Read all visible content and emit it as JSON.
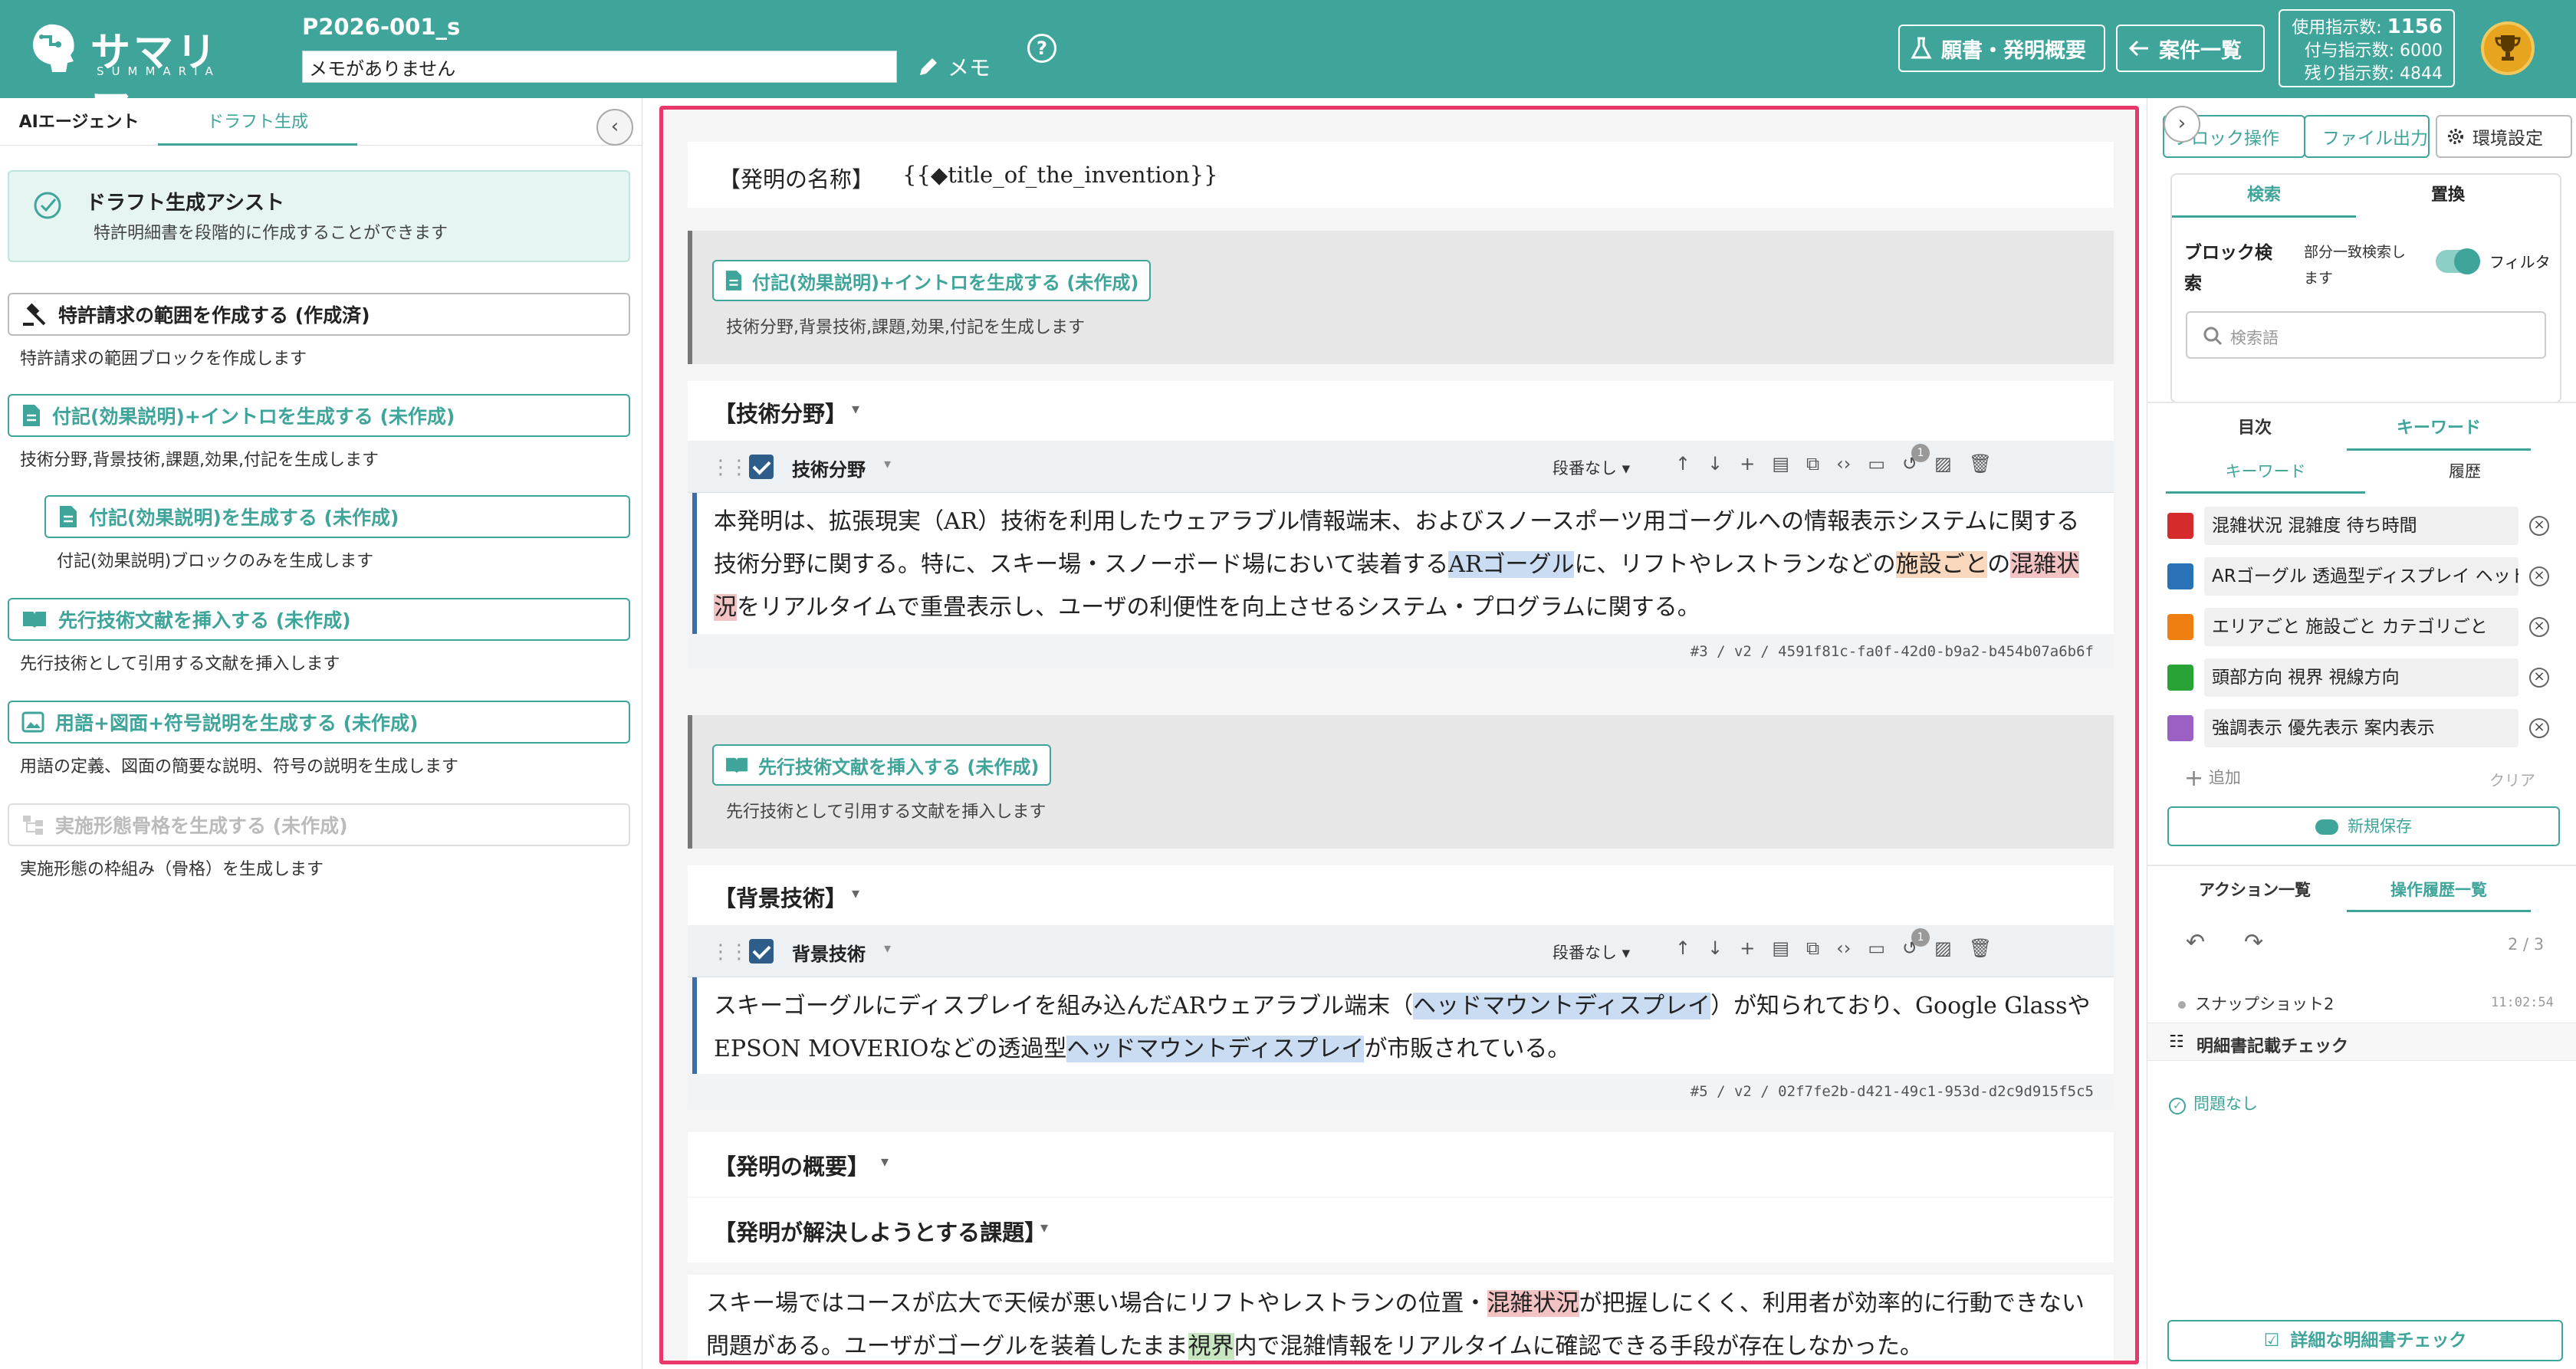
{
  "header": {
    "logo_jp": "サマリア",
    "logo_en": "SUMMARIA",
    "project_id": "P2026-001_s",
    "memo_value": "メモがありません",
    "memo_label": "メモ",
    "help_label": "?",
    "btn_application": "願書・発明概要",
    "btn_cases": "案件一覧",
    "stats": {
      "used_label": "使用指示数:",
      "used_value": "1156",
      "granted": "付与指示数: 6000",
      "remaining": "残り指示数: 4844"
    }
  },
  "left": {
    "tabs": [
      "AIエージェント",
      "ドラフト生成"
    ],
    "assist_title": "ドラフト生成アシスト",
    "assist_desc": "特許明細書を段階的に作成することができます",
    "steps": [
      {
        "label": "特許請求の範囲を作成する (作成済)",
        "desc": "特許請求の範囲ブロックを作成します"
      },
      {
        "label": "付記(効果説明)+イントロを生成する (未作成)",
        "desc": "技術分野,背景技術,課題,効果,付記を生成します"
      },
      {
        "label": "付記(効果説明)を生成する (未作成)",
        "desc": "付記(効果説明)ブロックのみを生成します"
      },
      {
        "label": "先行技術文献を挿入する (未作成)",
        "desc": "先行技術として引用する文献を挿入します"
      },
      {
        "label": "用語+図面+符号説明を生成する (未作成)",
        "desc": "用語の定義、図面の簡要な説明、符号の説明を生成します"
      },
      {
        "label": "実施形態骨格を生成する (未作成)",
        "desc": "実施形態の枠組み（骨格）を生成します"
      }
    ]
  },
  "center": {
    "title_label": "【発明の名称】",
    "title_value": "{{◆title_of_the_invention}}",
    "gen_intro_btn": "付記(効果説明)+イントロを生成する (未作成)",
    "gen_intro_desc": "技術分野,背景技術,課題,効果,付記を生成します",
    "sec_tech": "【技術分野】",
    "blk1_name": "技術分野",
    "para_label": "段番なし",
    "badge": "1",
    "blk1_text": {
      "a": "本発明は、拡張現実（AR）技術を利用したウェアラブル情報端末、およびスノースポーツ用ゴーグルへの情報表示システムに関する技術分野に関する。特に、スキー場・スノーボード場において装着する",
      "b": "ARゴーグル",
      "c": "に、リフトやレストランなどの",
      "d": "施設ごと",
      "e": "の",
      "f": "混雑状況",
      "g": "をリアルタイムで重畳表示し、ユーザの利便性を向上させるシステム・プログラムに関する。"
    },
    "blk1_meta": "#3 / v2 / 4591f81c-fa0f-42d0-b9a2-b454b07a6b6f",
    "gen_prior_btn": "先行技術文献を挿入する (未作成)",
    "gen_prior_desc": "先行技術として引用する文献を挿入します",
    "sec_bg": "【背景技術】",
    "blk2_name": "背景技術",
    "blk2_text": {
      "a": "スキーゴーグルにディスプレイを組み込んだARウェアラブル端末（",
      "b": "ヘッドマウントディスプレイ",
      "c": "）が知られており、Google GlassやEPSON MOVERIOなどの透過型",
      "d": "ヘッドマウントディスプレイ",
      "e": "が市販されている。"
    },
    "blk2_meta": "#5 / v2 / 02f7fe2b-d421-49c1-953d-d2c9d915f5c5",
    "sec_summary": "【発明の概要】",
    "sec_problem": "【発明が解決しようとする課題】",
    "blk3_text": {
      "a": "スキー場ではコースが広大で天候が悪い場合にリフトやレストランの位置・",
      "b": "混雑状況",
      "c": "が把握しにくく、利用者が効率的に行動できない問題がある。ユーザがゴーグルを装着したまま",
      "d": "視界",
      "e": "内で混雑情報をリアルタイムに確認できる手段が存在しなかった。"
    }
  },
  "right": {
    "btn_block_ops": "ブロック操作",
    "btn_file": "ファイル出力",
    "btn_settings": "環境設定",
    "search_tabs": [
      "検索",
      "置換"
    ],
    "block_search_label": "ブロック検索",
    "partial_match": "部分一致検索します",
    "filter_label": "フィルタ",
    "search_placeholder": "検索語",
    "toc_tabs": [
      "目次",
      "キーワード"
    ],
    "kw_subtabs": [
      "キーワード",
      "履歴"
    ],
    "keywords": [
      {
        "text": "混雑状況 混雑度 待ち時間",
        "color": "#d62b2b"
      },
      {
        "text": "ARゴーグル 透過型ディスプレイ ヘッドマウントディスプレイ",
        "color": "#2a72b8"
      },
      {
        "text": "エリアごと 施設ごと カテゴリごと",
        "color": "#f07f12"
      },
      {
        "text": "頭部方向 視界 視線方向",
        "color": "#2aa336"
      },
      {
        "text": "強調表示 優先表示 案内表示",
        "color": "#9c5fc4"
      }
    ],
    "add_label": "追加",
    "clear_label": "クリア",
    "save_label": "新規保存",
    "action_tabs": [
      "アクション一覧",
      "操作履歴一覧"
    ],
    "history_pos": "2 / 3",
    "snapshot_label": "スナップショット2",
    "snapshot_time": "11:02:54",
    "check_title": "明細書記載チェック",
    "check_result": "問題なし",
    "detail_check": "詳細な明細書チェック"
  }
}
